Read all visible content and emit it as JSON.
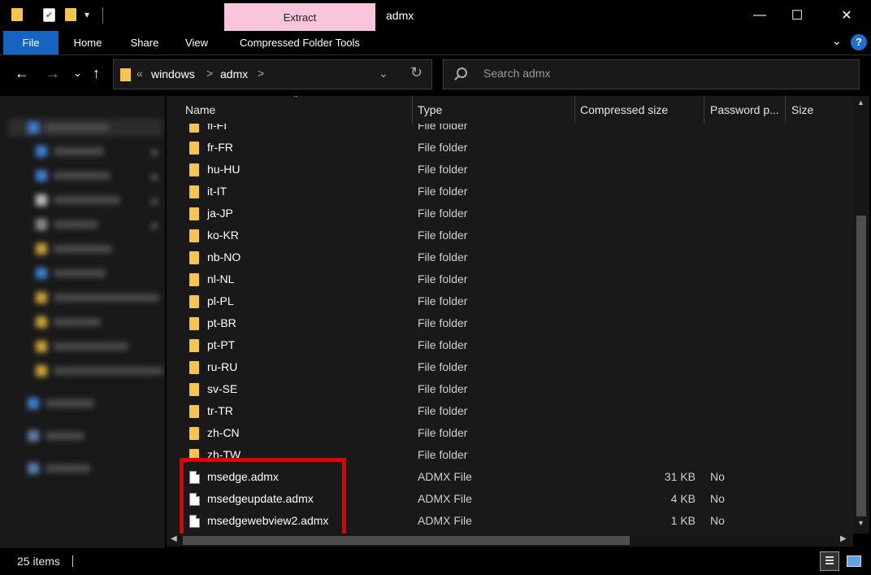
{
  "window": {
    "title": "admx",
    "contextual_tab": "Extract",
    "controls": {
      "minimize": "—",
      "maximize": "☐",
      "close": "✕"
    }
  },
  "ribbon": {
    "tabs": [
      "File",
      "Home",
      "Share",
      "View",
      "Compressed Folder Tools"
    ],
    "collapse_icon": "chevron-down-icon",
    "help": "?"
  },
  "address_bar": {
    "overflow": "«",
    "segments": [
      "windows",
      "admx"
    ],
    "separator": ">"
  },
  "search": {
    "placeholder": "Search admx"
  },
  "columns": {
    "name": "Name",
    "type": "Type",
    "compressed_size": "Compressed size",
    "password": "Password p...",
    "size": "Size"
  },
  "files": [
    {
      "name": "fi-FI",
      "type": "File folder",
      "kind": "folder",
      "compressed_size": "",
      "password": ""
    },
    {
      "name": "fr-FR",
      "type": "File folder",
      "kind": "folder",
      "compressed_size": "",
      "password": ""
    },
    {
      "name": "hu-HU",
      "type": "File folder",
      "kind": "folder",
      "compressed_size": "",
      "password": ""
    },
    {
      "name": "it-IT",
      "type": "File folder",
      "kind": "folder",
      "compressed_size": "",
      "password": ""
    },
    {
      "name": "ja-JP",
      "type": "File folder",
      "kind": "folder",
      "compressed_size": "",
      "password": ""
    },
    {
      "name": "ko-KR",
      "type": "File folder",
      "kind": "folder",
      "compressed_size": "",
      "password": ""
    },
    {
      "name": "nb-NO",
      "type": "File folder",
      "kind": "folder",
      "compressed_size": "",
      "password": ""
    },
    {
      "name": "nl-NL",
      "type": "File folder",
      "kind": "folder",
      "compressed_size": "",
      "password": ""
    },
    {
      "name": "pl-PL",
      "type": "File folder",
      "kind": "folder",
      "compressed_size": "",
      "password": ""
    },
    {
      "name": "pt-BR",
      "type": "File folder",
      "kind": "folder",
      "compressed_size": "",
      "password": ""
    },
    {
      "name": "pt-PT",
      "type": "File folder",
      "kind": "folder",
      "compressed_size": "",
      "password": ""
    },
    {
      "name": "ru-RU",
      "type": "File folder",
      "kind": "folder",
      "compressed_size": "",
      "password": ""
    },
    {
      "name": "sv-SE",
      "type": "File folder",
      "kind": "folder",
      "compressed_size": "",
      "password": ""
    },
    {
      "name": "tr-TR",
      "type": "File folder",
      "kind": "folder",
      "compressed_size": "",
      "password": ""
    },
    {
      "name": "zh-CN",
      "type": "File folder",
      "kind": "folder",
      "compressed_size": "",
      "password": ""
    },
    {
      "name": "zh-TW",
      "type": "File folder",
      "kind": "folder",
      "compressed_size": "",
      "password": ""
    },
    {
      "name": "msedge.admx",
      "type": "ADMX File",
      "kind": "file",
      "compressed_size": "31 KB",
      "password": "No"
    },
    {
      "name": "msedgeupdate.admx",
      "type": "ADMX File",
      "kind": "file",
      "compressed_size": "4 KB",
      "password": "No"
    },
    {
      "name": "msedgewebview2.admx",
      "type": "ADMX File",
      "kind": "file",
      "compressed_size": "1 KB",
      "password": "No"
    }
  ],
  "status": {
    "item_count": "25 items"
  },
  "colors": {
    "accent": "#1565c0",
    "extract_tab": "#f8c5dc",
    "folder": "#f5c451",
    "highlight": "#e30000"
  }
}
